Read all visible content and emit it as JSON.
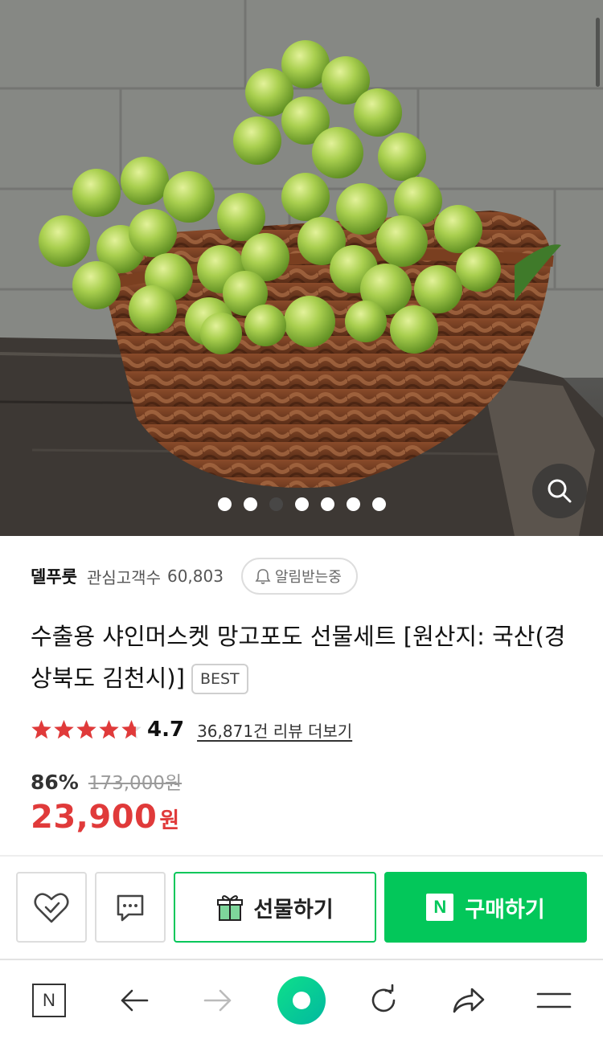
{
  "gallery": {
    "dots": [
      {
        "active": false
      },
      {
        "active": false
      },
      {
        "active": true
      },
      {
        "active": false
      },
      {
        "active": false
      },
      {
        "active": false
      },
      {
        "active": false
      }
    ],
    "zoom_icon": "magnifier-icon"
  },
  "store": {
    "name": "델푸룻",
    "fans_label": "관심고객수",
    "fans_count": "60,803",
    "alarm_label": "알림받는중",
    "alarm_icon": "bell-icon"
  },
  "product": {
    "title": "수출용 샤인머스켓 망고포도 선물세트 [원산지: 국산(경상북도 김천시)]",
    "badge": "BEST",
    "rating": "4.7",
    "star_fill": 0.94,
    "review_link": "36,871건 리뷰 더보기",
    "discount": "86%",
    "original_price": "173,000원",
    "price": "23,900",
    "currency": "원"
  },
  "actions": {
    "wishlist_icon": "heart-check-icon",
    "talk_icon": "chat-bubble-icon",
    "gift_label": "선물하기",
    "gift_icon": "gift-icon",
    "buy_label": "구매하기",
    "buy_logo": "N"
  },
  "bottom_nav": {
    "home_logo": "N",
    "items": [
      "naver-home-icon",
      "back-arrow-icon",
      "forward-arrow-icon",
      "green-dot-icon",
      "reload-icon",
      "share-icon",
      "menu-icon"
    ]
  },
  "colors": {
    "accent_green": "#03c75a",
    "price_red": "#e03a3a",
    "star_red": "#e03a3a"
  }
}
